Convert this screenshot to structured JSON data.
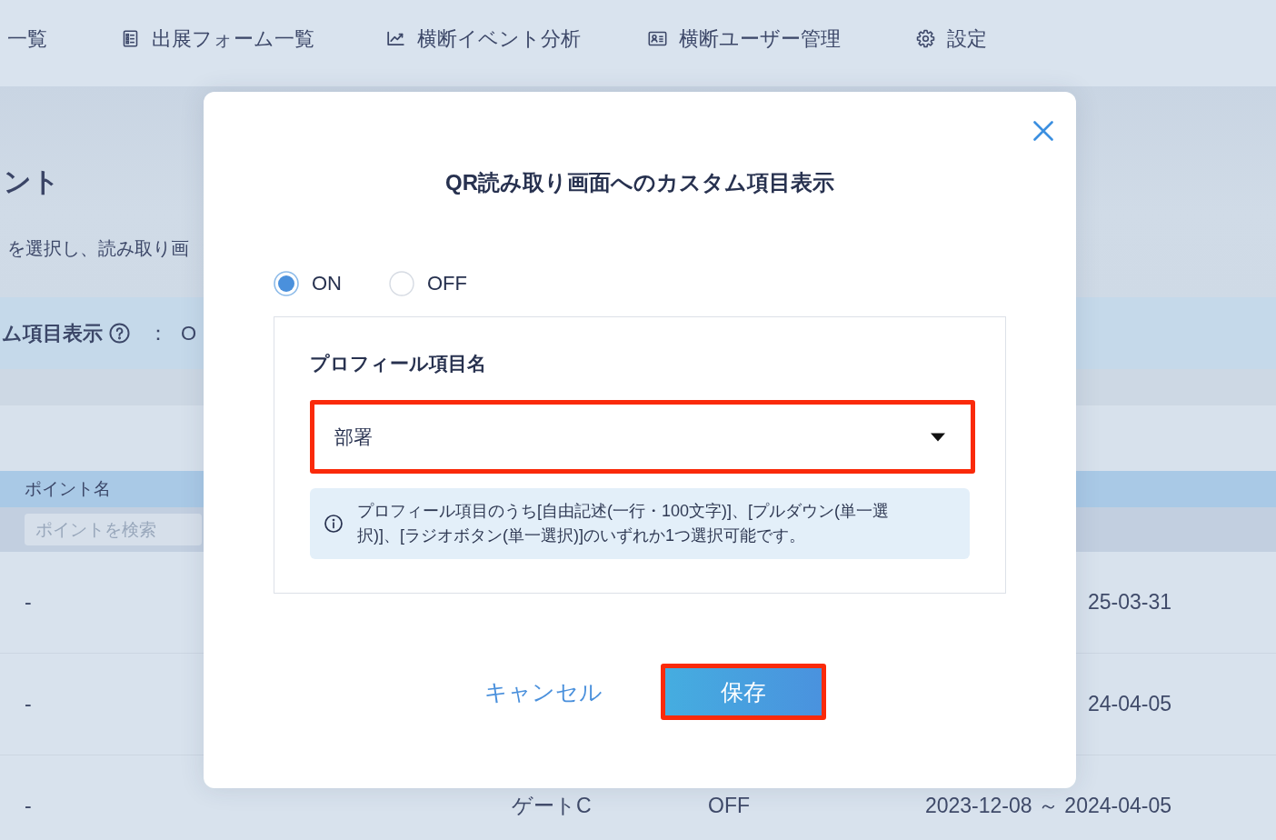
{
  "nav": {
    "items": [
      {
        "label": "一覧"
      },
      {
        "label": "出展フォーム一覧"
      },
      {
        "label": "横断イベント分析"
      },
      {
        "label": "横断ユーザー管理"
      },
      {
        "label": "設定"
      }
    ]
  },
  "page": {
    "heading": "ント",
    "description": "を選択し、読み取り画",
    "setting": {
      "label": "ム項目表示",
      "separator": "：",
      "value": "O"
    }
  },
  "table": {
    "columns": [
      {
        "label": "ポイント名"
      }
    ],
    "search": {
      "placeholder": "ポイントを検索"
    },
    "rows": [
      {
        "point_name": "-",
        "period": "25-03-31"
      },
      {
        "point_name": "-",
        "period": "24-04-05"
      },
      {
        "point_name": "-",
        "gate": "ゲートC",
        "status": "OFF",
        "period": "2023-12-08 ～ 2024-04-05"
      }
    ]
  },
  "dialog": {
    "title": "QR読み取り画面へのカスタム項目表示",
    "radios": [
      {
        "label": "ON",
        "selected": true
      },
      {
        "label": "OFF",
        "selected": false
      }
    ],
    "section": {
      "label": "プロフィール項目名",
      "select": {
        "value": "部署",
        "highlighted": true
      },
      "note": "プロフィール項目のうち[自由記述(一行・100文字)]、[プルダウン(単一選択)]、[ラジオボタン(単一選択)]のいずれか1つ選択可能です。"
    },
    "buttons": [
      {
        "kind": "text",
        "label": "キャンセル",
        "highlighted": false
      },
      {
        "kind": "primary",
        "label": "保存",
        "highlighted": true
      }
    ]
  }
}
